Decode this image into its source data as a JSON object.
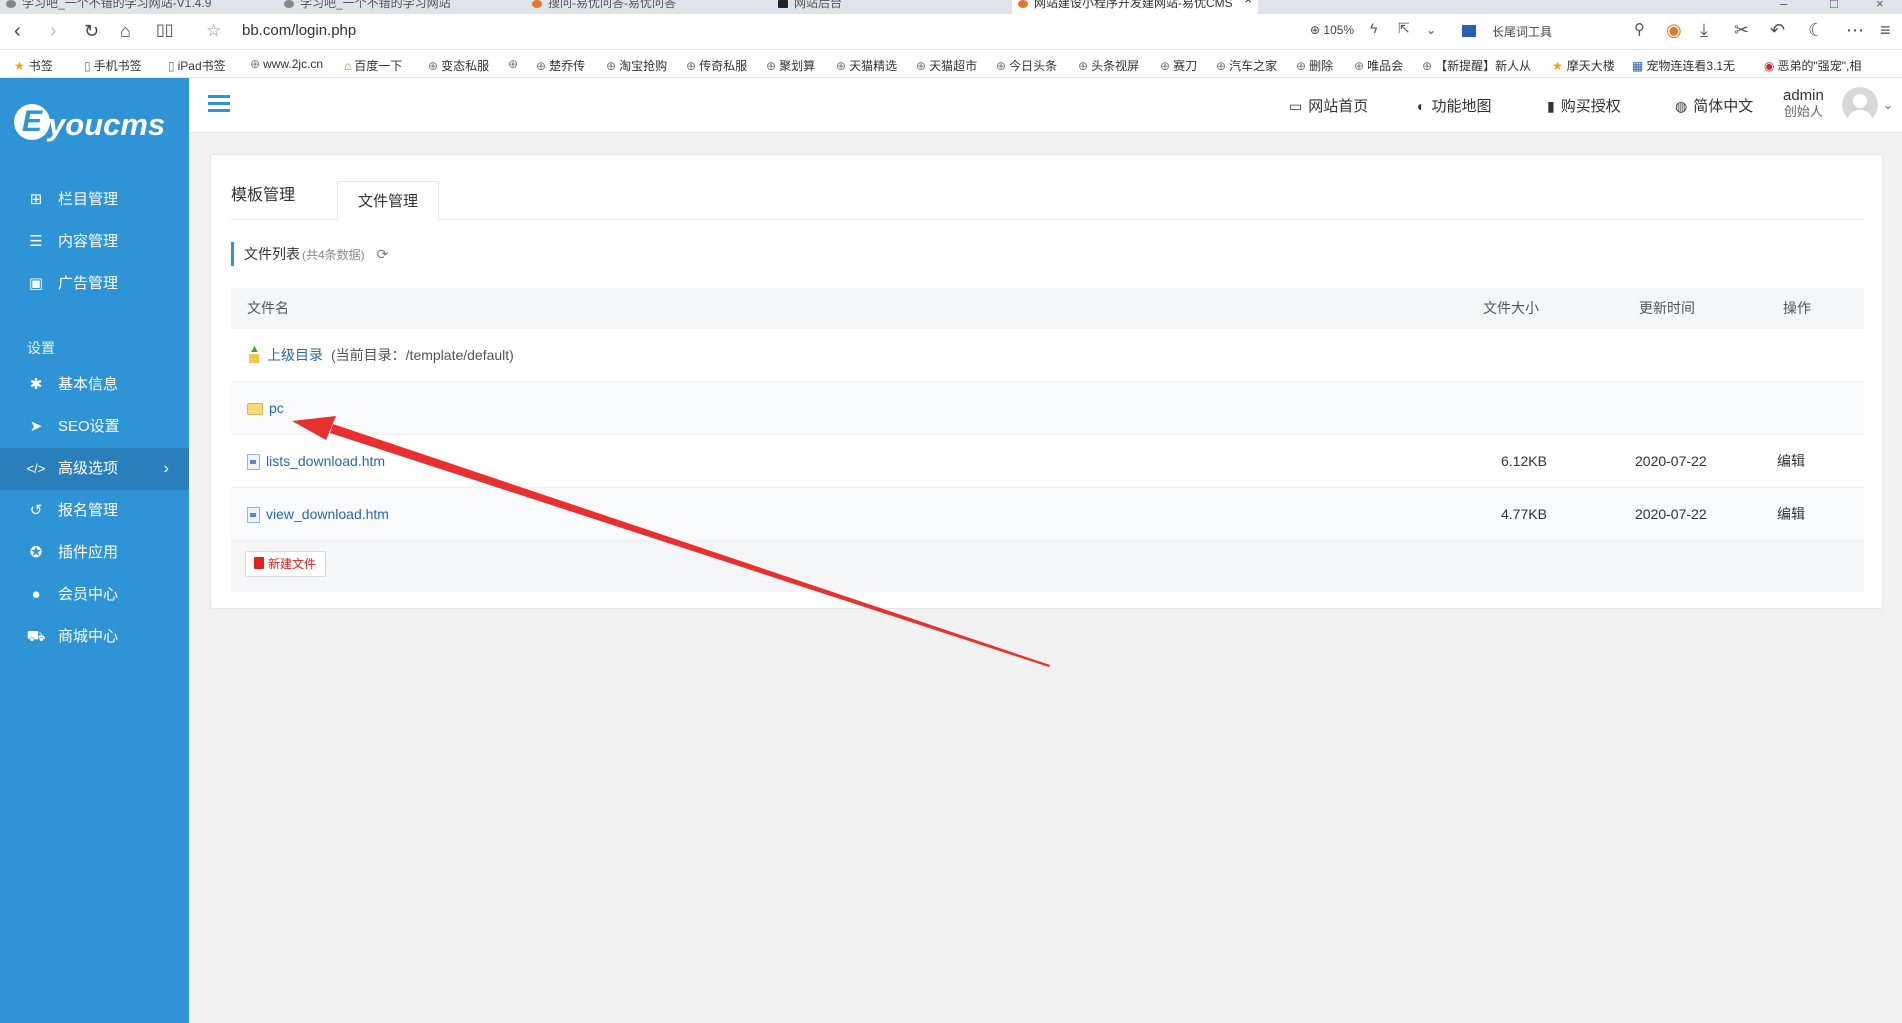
{
  "browser": {
    "tabs": [
      {
        "title": "学习吧_一个不错的学习网站-V1.4.9"
      },
      {
        "title": "学习吧_一个不错的学习网站"
      },
      {
        "title": "搜问-易优问答-易优问答"
      },
      {
        "title": "网站后台"
      },
      {
        "title": "网站建设小程序开发建网站-易优CMS"
      }
    ],
    "url": "bb.com/login.php",
    "zoom": "105%",
    "toolbar_tool": "长尾词工具",
    "bookmarks": [
      "书签",
      "手机书签",
      "iPad书签",
      "www.2jc.cn",
      "百度一下",
      "变态私服",
      "楚乔传",
      "淘宝抢购",
      "传奇私服",
      "聚划算",
      "天猫精选",
      "天猫超市",
      "今日头条",
      "头条视屏",
      "赛刀",
      "汽车之家",
      "删除",
      "唯品会",
      "【新提醒】新人从",
      "摩天大楼",
      "宠物连连看3.1无",
      "恶弟的\"强宠\",相"
    ]
  },
  "app": {
    "logo_text": "youcms",
    "logo_letter": "E",
    "sidebar": {
      "top_items": [
        {
          "label": "栏目管理",
          "icon": "sitemap-icon"
        },
        {
          "label": "内容管理",
          "icon": "list-icon"
        },
        {
          "label": "广告管理",
          "icon": "image-icon"
        }
      ],
      "section_label": "设置",
      "settings_items": [
        {
          "label": "基本信息",
          "icon": "gear-icon"
        },
        {
          "label": "SEO设置",
          "icon": "paper-plane-icon"
        },
        {
          "label": "高级选项",
          "icon": "code-icon",
          "active": true
        },
        {
          "label": "报名管理",
          "icon": "refresh-icon"
        },
        {
          "label": "插件应用",
          "icon": "puzzle-icon"
        },
        {
          "label": "会员中心",
          "icon": "user-icon"
        },
        {
          "label": "商城中心",
          "icon": "cart-icon"
        }
      ]
    },
    "topbar": {
      "links": [
        {
          "label": "网站首页",
          "icon": "monitor-icon"
        },
        {
          "label": "功能地图",
          "icon": "toggle-icon"
        },
        {
          "label": "购买授权",
          "icon": "bookmark-icon"
        },
        {
          "label": "简体中文",
          "icon": "globe-icon"
        }
      ],
      "user_name": "admin",
      "user_role": "创始人"
    },
    "panel": {
      "tabs": [
        {
          "label": "模板管理",
          "active": false
        },
        {
          "label": "文件管理",
          "active": true
        }
      ],
      "list_title": "文件列表",
      "list_count": "(共4条数据)",
      "table": {
        "headers": {
          "name": "文件名",
          "size": "文件大小",
          "time": "更新时间",
          "op": "操作"
        },
        "up_label": "上级目录",
        "up_note": "(当前目录：/template/default)",
        "rows": [
          {
            "type": "folder",
            "name": "pc",
            "size": "",
            "time": "",
            "op": ""
          },
          {
            "type": "file",
            "name": "lists_download.htm",
            "size": "6.12KB",
            "time": "2020-07-22",
            "op": "编辑"
          },
          {
            "type": "file",
            "name": "view_download.htm",
            "size": "4.77KB",
            "time": "2020-07-22",
            "op": "编辑"
          }
        ]
      },
      "new_file_button": "新建文件"
    },
    "annotation": {
      "color": "#e8302f"
    }
  }
}
